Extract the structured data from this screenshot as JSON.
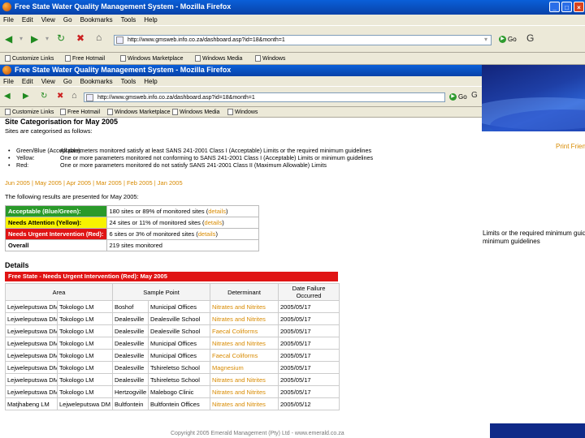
{
  "back_window": {
    "title": "Free State Water Quality Management System - Mozilla Firefox",
    "menu": [
      "File",
      "Edit",
      "View",
      "Go",
      "Bookmarks",
      "Tools",
      "Help"
    ],
    "url": "http://www.gmsweb.info.co.za/dashboard.asp?id=18&month=1",
    "go_label": "Go",
    "links": [
      "Customize Links",
      "Free Hotmail",
      "Windows Marketplace",
      "Windows Media",
      "Windows"
    ],
    "window_buttons": [
      "_",
      "□",
      "×"
    ]
  },
  "front_window": {
    "title": "Free State Water Quality Management System - Mozilla Firefox",
    "menu": [
      "File",
      "Edit",
      "View",
      "Go",
      "Bookmarks",
      "Tools",
      "Help"
    ],
    "url": "http://www.gmsweb.info.co.za/dashboard.asp?id=18&month=1",
    "go_label": "Go",
    "links": [
      "Customize Links",
      "Free Hotmail",
      "Windows Marketplace",
      "Windows Media",
      "Windows"
    ]
  },
  "page": {
    "heading": "Site Categorisation for May 2005",
    "intro": "Sites are categorised as follows:",
    "categories": [
      {
        "key": "Green/Blue (Acceptable):",
        "text": "All parameters monitored satisfy at least SANS 241-2001 Class I (Acceptable) Limits or the required minimum guidelines"
      },
      {
        "key": "Yellow:",
        "text": "One or more parameters monitored not conforming to SANS 241-2001 Class I (Acceptable) Limits or minimum guidelines"
      },
      {
        "key": "Red:",
        "text": "One or more parameters monitored do not satisfy SANS 241-2001 Class II (Maximum Allowable) Limits"
      }
    ],
    "month_links": "Jun 2005 | May 2005 | Apr 2005 | Mar 2005 | Feb 2005 | Jan 2005",
    "results_intro": "The following results are presented for May 2005:",
    "summary": [
      {
        "label": "Acceptable (Blue/Green):",
        "value": "180 sites or 89% of monitored sites",
        "link": "details"
      },
      {
        "label": "Needs Attention (Yellow):",
        "value": "24 sites or 11% of monitored sites",
        "link": "details"
      },
      {
        "label": "Needs Urgent Intervention (Red):",
        "value": "6 sites or 3% of monitored sites",
        "link": "details"
      },
      {
        "label": "Overall",
        "value": "219 sites monitored",
        "link": ""
      }
    ],
    "details_heading": "Details",
    "details_title": "Free State - Needs Urgent Intervention (Red): May 2005",
    "columns": [
      "Area",
      "",
      "Sample Point",
      "Determinant",
      "Date Failure Occurred"
    ],
    "rows": [
      [
        "Lejweleputswa DM",
        "Tokologo LM",
        "Boshof",
        "Municipal Offices",
        "Nitrates and Nitrites",
        "2005/05/17"
      ],
      [
        "Lejweleputswa DM",
        "Tokologo LM",
        "Dealesville",
        "Dealesville School",
        "Nitrates and Nitrites",
        "2005/05/17"
      ],
      [
        "Lejweleputswa DM",
        "Tokologo LM",
        "Dealesville",
        "Dealesville School",
        "Faecal Coliforms",
        "2005/05/17"
      ],
      [
        "Lejweleputswa DM",
        "Tokologo LM",
        "Dealesville",
        "Municipal Offices",
        "Nitrates and Nitrites",
        "2005/05/17"
      ],
      [
        "Lejweleputswa DM",
        "Tokologo LM",
        "Dealesville",
        "Municipal Offices",
        "Faecal Coliforms",
        "2005/05/17"
      ],
      [
        "Lejweleputswa DM",
        "Tokologo LM",
        "Dealesville",
        "Tshireletso School",
        "Magnesium",
        "2005/05/17"
      ],
      [
        "Lejweleputswa DM",
        "Tokologo LM",
        "Dealesville",
        "Tshireletso School",
        "Nitrates and Nitrites",
        "2005/05/17"
      ],
      [
        "Lejweleputswa DM",
        "Tokologo LM",
        "Hertzogville",
        "Malebogo Clinic",
        "Nitrates and Nitrites",
        "2005/05/17"
      ],
      [
        "Matjhabeng LM",
        "Lejweleputswa DM",
        "Bultfontein",
        "Bultfontein Offices",
        "Nitrates and Nitrites",
        "2005/05/12"
      ]
    ],
    "right_texts": [
      "Print Friendly",
      "Limits or the required minimum guidelines",
      "minimum guidelines"
    ],
    "footer": "Copyright 2005 Emerald Management (Pty) Ltd - www.emerald.co.za"
  }
}
